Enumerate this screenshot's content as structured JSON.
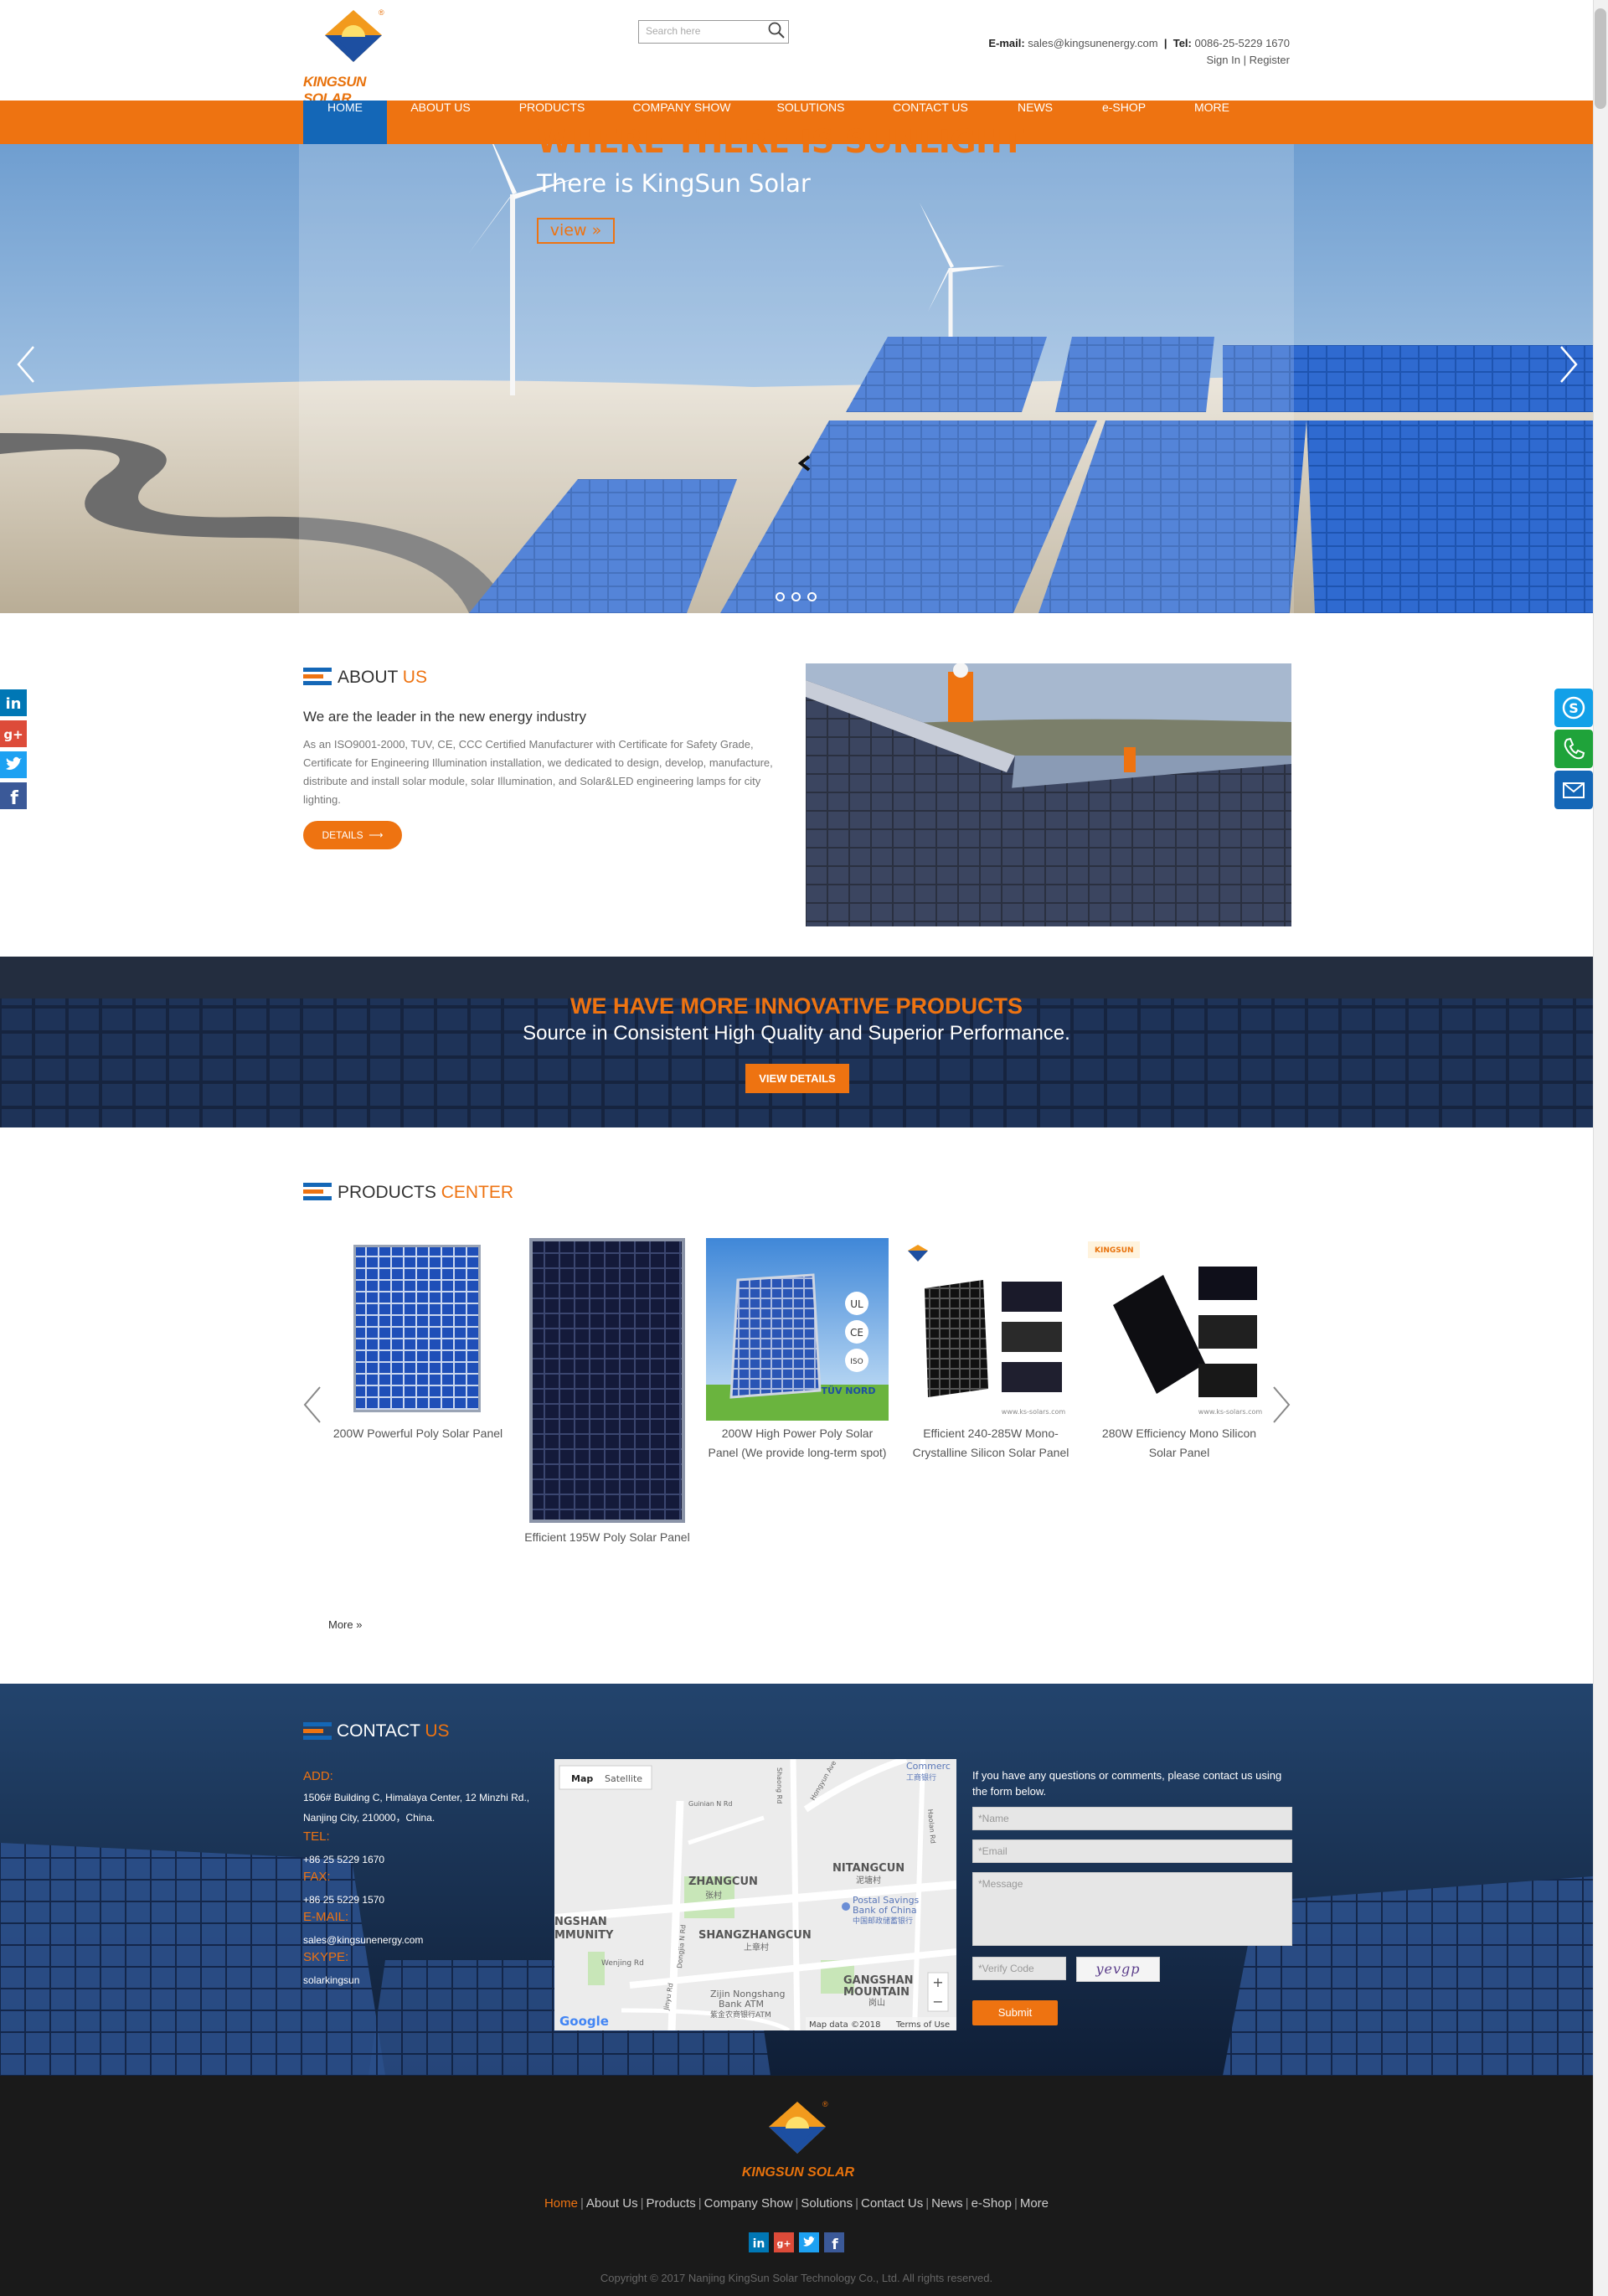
{
  "header": {
    "logo_text": "KINGSUN SOLAR",
    "search_placeholder": "Search here",
    "email_label": "E-mail:",
    "email": "sales@kingsunenergy.com",
    "tel_label": "Tel:",
    "tel": "0086-25-5229 1670",
    "sign_in": "Sign In",
    "register": "Register",
    "divider": "|"
  },
  "nav": {
    "items": [
      {
        "label": "HOME",
        "active": true
      },
      {
        "label": "ABOUT US"
      },
      {
        "label": "PRODUCTS"
      },
      {
        "label": "COMPANY SHOW"
      },
      {
        "label": "SOLUTIONS"
      },
      {
        "label": "CONTACT US"
      },
      {
        "label": "NEWS"
      },
      {
        "label": "e-SHOP"
      },
      {
        "label": "MORE"
      }
    ]
  },
  "hero": {
    "title": "WHERE THERE IS SUNLIGHT",
    "subtitle": "There is KingSun Solar",
    "button": "view »",
    "slides": 3
  },
  "about": {
    "title_a": "ABOUT ",
    "title_b": "US",
    "lead": "We are the leader in the new energy industry",
    "text": "As an ISO9001-2000, TUV, CE, CCC Certified Manufacturer with Certificate for Safety Grade, Certificate for Engineering Illumination installation, we dedicated to design, develop, manufacture, distribute and install solar module, solar Illumination, and Solar&LED engineering lamps for city lighting.",
    "button": "DETAILS"
  },
  "banner": {
    "title": "WE HAVE MORE INNOVATIVE PRODUCTS",
    "subtitle": "Source in Consistent High Quality and Superior Performance.",
    "button": "VIEW DETAILS"
  },
  "products": {
    "title_a": "PRODUCTS ",
    "title_b": "CENTER",
    "items": [
      {
        "name": "200W Powerful Poly Solar Panel"
      },
      {
        "name": "Efficient 195W Poly Solar Panel"
      },
      {
        "name": "200W High Power Poly Solar Panel (We provide long-term spot)"
      },
      {
        "name": "Efficient 240-285W Mono-Crystalline Silicon Solar Panel"
      },
      {
        "name": "280W Efficiency Mono Silicon Solar Panel"
      }
    ],
    "more": "More »"
  },
  "contact": {
    "title_a": "CONTACT ",
    "title_b": "US",
    "add_label": "ADD:",
    "add": "1506# Building C, Himalaya Center, 12 Minzhi Rd., Nanjing City, 210000，China.",
    "tel_label": "TEL:",
    "tel": "+86 25 5229 1670",
    "fax_label": "FAX:",
    "fax": "+86 25 5229 1570",
    "email_label": "E-MAIL:",
    "email": "sales@kingsunenergy.com",
    "skype_label": "SKYPE:",
    "skype": "solarkingsun",
    "map": {
      "tab_map": "Map",
      "tab_satellite": "Satellite",
      "labels": [
        "ZHANGCUN",
        "张村",
        "NITANGCUN",
        "泥塘村",
        "SHANGZHANGCUN",
        "上章村",
        "NGSHAN",
        "MMUNITY",
        "GANGSHAN",
        "MOUNTAIN",
        "岗山",
        "Postal Savings",
        "Bank of China",
        "中国邮政储蓄银行",
        "Zijin Nongshang",
        "Bank ATM",
        "紫金农商银行ATM",
        "Commerc",
        "工商银行",
        "Wenjing Rd",
        "Guinian N Rd",
        "Hongyun Ave",
        "Dongjia N Rd",
        "Haolan Rd",
        "Shaong Rd",
        "Jinyu Rd"
      ],
      "google": "Google",
      "map_data": "Map data ©2018",
      "terms": "Terms of Use"
    },
    "form_intro": "If you have any questions or comments, please contact us using the form below.",
    "name_ph": "*Name",
    "email_ph": "*Email",
    "message_ph": "*Message",
    "verify_ph": "*Verify Code",
    "captcha": "yevgp",
    "submit": "Submit"
  },
  "footer": {
    "logo_text": "KINGSUN SOLAR",
    "links": [
      "Home",
      "About Us",
      "Products",
      "Company Show",
      "Solutions",
      "Contact Us",
      "News",
      "e-Shop",
      "More"
    ],
    "copyright": "Copyright © 2017 Nanjing KingSun Solar Technology Co., Ltd. All rights reserved."
  },
  "colors": {
    "accent": "#ee7311",
    "nav_active": "#1467b7",
    "footer_bg": "#1a1a1a"
  },
  "icons": [
    "search-icon",
    "linkedin-icon",
    "google-plus-icon",
    "twitter-icon",
    "facebook-icon",
    "skype-icon",
    "phone-icon",
    "mail-icon",
    "chevron-left-icon",
    "chevron-right-icon",
    "arrow-right-icon"
  ]
}
